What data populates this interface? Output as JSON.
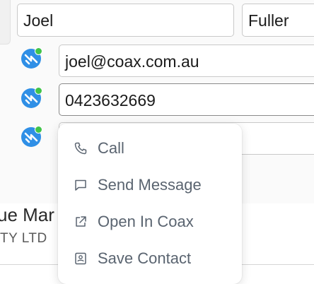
{
  "form": {
    "first_name": "Joel",
    "last_name": "Fuller",
    "email": "joel@coax.com.au",
    "phone": "0423632669",
    "third_field": ""
  },
  "contact_icon": {
    "name": "coax-contact-icon",
    "status_color": "#41c44a",
    "brand_color": "#2f8fe6"
  },
  "background": {
    "contact_name_partial": "ue Mar",
    "company_partial": "TY LTD"
  },
  "menu": {
    "items": [
      {
        "label": "Call",
        "icon": "phone-icon"
      },
      {
        "label": "Send Message",
        "icon": "message-icon"
      },
      {
        "label": "Open In Coax",
        "icon": "external-link-icon"
      },
      {
        "label": "Save Contact",
        "icon": "contact-card-icon"
      }
    ]
  },
  "colors": {
    "menu_text": "#5a6470",
    "accent": "#2f8fe6"
  }
}
